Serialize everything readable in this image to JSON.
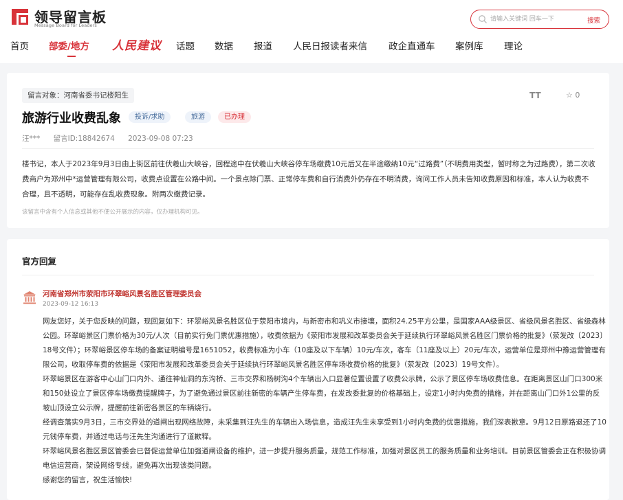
{
  "header": {
    "logo_cn": "领导留言板",
    "logo_en": "Message Board for Leaders",
    "search_placeholder": "请输入关键词 回车一下",
    "search_button": "搜索"
  },
  "nav": {
    "items": [
      {
        "label": "首页"
      },
      {
        "label": "部委/地方",
        "active": true
      },
      {
        "label": "人民建议"
      },
      {
        "label": "话题"
      },
      {
        "label": "数据"
      },
      {
        "label": "报道"
      },
      {
        "label": "人民日报读者来信"
      },
      {
        "label": "政企直通车"
      },
      {
        "label": "案例库"
      },
      {
        "label": "理论"
      }
    ]
  },
  "message": {
    "recipient": "留言对象：河南省委书记楼阳生",
    "title": "旅游行业收费乱象",
    "tags": {
      "type": "投诉/求助",
      "category": "旅游",
      "status": "已办理"
    },
    "star_count": "0",
    "font_toggle": "TT",
    "author": "汪***",
    "id": "留言ID:18842674",
    "time": "2023-09-08 07:23",
    "body": "楼书记，本人于2023年9月3日由上街区前往伏羲山大峡谷，回程途中在伏羲山大峡谷停车场缴费10元后又在半途缴纳10元“过路费”（不明费用类型，暂时称之为过路费），第二次收费商户为郑州中*运营管理有限公司，收费点设置在公路中间。一个景点除门票、正常停车费和自行消费外仍存在不明消费，询问工作人员未告知收费原因和标准，本人认为收费不合理，且不透明，可能存在乱收费现象。附两次缴费记录。",
    "note": "该留言中含有个人信息或其他不便公开展示的内容，仅办理机构可见。"
  },
  "reply": {
    "section_title": "官方回复",
    "org": "河南省郑州市荥阳市环翠峪风景名胜区管理委员会",
    "time": "2023-09-12 16:13",
    "paragraphs": [
      "网友您好，关于您反映的问题，现回复如下：环翠峪风景名胜区位于荥阳市境内，与新密市和巩义市接壤，面积24.25平方公里，是国家AAA级景区、省级风景名胜区、省级森林公园。环翠峪景区门票价格为30元/人次（目前实行免门票优惠措施），收费依据为《荥阳市发展和改革委员会关于延续执行环翠峪风景名胜区门票价格的批复》（荥发改〔2023〕18号文件）；环翠峪景区停车场的备案证明编号是1651052，收费标准为小车（10座及以下车辆）10元/车次，客车（11座及以上）20元/车次，运营单位是郑州中豫运营管理有限公司，收取停车费的依据是《荥阳市发展和改革委员会关于延续执行环翠峪风景名胜区停车场收费价格的批复》（荥发改〔2023〕19号文件）。",
      "环翠峪景区在游客中心山门口内外、通往神仙洞的东沟桥、三市交界和杨树沟4个车辆出入口显著位置设置了收费公示牌，公示了景区停车场收费信息。在距离景区山门口300米和150处设立了景区停车场缴费提醒牌子，为了避免通过景区前往新密的车辆产生停车费，在发改委批复的价格基础上，设定1小时内免费的措施，并在距离山门口外1公里的反坡山顶设立公示牌，提醒前往新密各景区的车辆绕行。",
      "经调查落实9月3日，三市交界处的道闸出现网络故障，未采集到汪先生的车辆出入场信息，造成汪先生未享受到1小时内免费的优惠措施，我们深表歉意。9月12日原路退还了10元钱停车费，并通过电话与汪先生沟通进行了道歉释。",
      "环翠峪风景名胜区景区管委会已督促运营单位加强道闸设备的维护，进一步提升服务质量，规范工作标准，加强对景区员工的服务质量和业务培训。目前景区管委会正在积极协调电信运营商，架设网络专线，避免再次出现该类问题。",
      "感谢您的留言，祝生活愉快!"
    ]
  }
}
